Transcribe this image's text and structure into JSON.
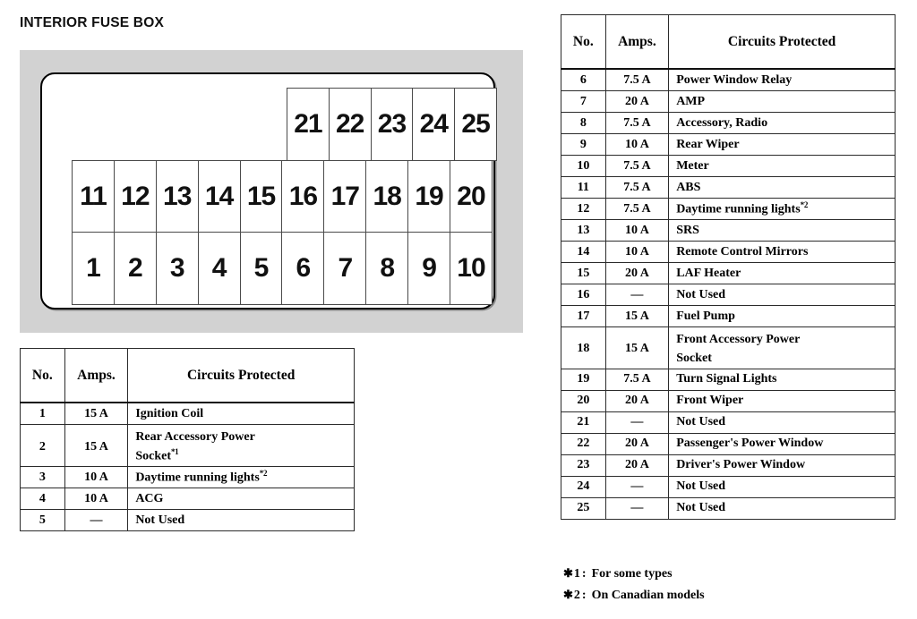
{
  "page_title": "INTERIOR FUSE BOX",
  "diagram": {
    "name": "interior-fuse-box-layout",
    "rows": {
      "top": [
        "21",
        "22",
        "23",
        "24",
        "25"
      ],
      "middle": [
        "11",
        "12",
        "13",
        "14",
        "15",
        "16",
        "17",
        "18",
        "19",
        "20"
      ],
      "bottom": [
        "1",
        "2",
        "3",
        "4",
        "5",
        "6",
        "7",
        "8",
        "9",
        "10"
      ]
    },
    "background_color": "#d2d2d2",
    "panel_color": "#ffffff"
  },
  "table_headers": {
    "no": "No.",
    "amps": "Amps.",
    "circuits": "Circuits Protected"
  },
  "left_table": {
    "rows": [
      {
        "no": "1",
        "amps": "15 A",
        "circuit": "Ignition Coil"
      },
      {
        "no": "2",
        "amps": "15 A",
        "circuit_line1": "Rear Accessory Power",
        "circuit_line2": "Socket",
        "footnote": "*1",
        "tall": true
      },
      {
        "no": "3",
        "amps": "10 A",
        "circuit": "Daytime running lights",
        "footnote": "*2"
      },
      {
        "no": "4",
        "amps": "10 A",
        "circuit": "ACG"
      },
      {
        "no": "5",
        "amps": "—",
        "circuit": "Not Used"
      }
    ]
  },
  "right_table": {
    "rows": [
      {
        "no": "6",
        "amps": "7.5 A",
        "circuit": "Power Window Relay"
      },
      {
        "no": "7",
        "amps": "20 A",
        "circuit": "AMP"
      },
      {
        "no": "8",
        "amps": "7.5 A",
        "circuit": "Accessory, Radio"
      },
      {
        "no": "9",
        "amps": "10 A",
        "circuit": "Rear Wiper"
      },
      {
        "no": "10",
        "amps": "7.5 A",
        "circuit": "Meter"
      },
      {
        "no": "11",
        "amps": "7.5 A",
        "circuit": "ABS"
      },
      {
        "no": "12",
        "amps": "7.5 A",
        "circuit": "Daytime running lights",
        "footnote": "*2"
      },
      {
        "no": "13",
        "amps": "10 A",
        "circuit": "SRS"
      },
      {
        "no": "14",
        "amps": "10 A",
        "circuit": "Remote Control Mirrors"
      },
      {
        "no": "15",
        "amps": "20 A",
        "circuit": "LAF Heater"
      },
      {
        "no": "16",
        "amps": "—",
        "circuit": "Not Used"
      },
      {
        "no": "17",
        "amps": "15 A",
        "circuit": "Fuel Pump"
      },
      {
        "no": "18",
        "amps": "15 A",
        "circuit_line1": "Front Accessory Power",
        "circuit_line2": "Socket",
        "tall": true
      },
      {
        "no": "19",
        "amps": "7.5 A",
        "circuit": "Turn Signal Lights"
      },
      {
        "no": "20",
        "amps": "20 A",
        "circuit": "Front Wiper"
      },
      {
        "no": "21",
        "amps": "—",
        "circuit": "Not Used"
      },
      {
        "no": "22",
        "amps": "20 A",
        "circuit": "Passenger's Power Window"
      },
      {
        "no": "23",
        "amps": "20 A",
        "circuit": "Driver's Power Window"
      },
      {
        "no": "24",
        "amps": "—",
        "circuit": "Not Used"
      },
      {
        "no": "25",
        "amps": "—",
        "circuit": "Not Used"
      }
    ]
  },
  "footnotes": [
    {
      "marker": "✱",
      "num": "1",
      "colon": ":",
      "text": "For some types"
    },
    {
      "marker": "✱",
      "num": "2",
      "colon": ":",
      "text": "On Canadian models"
    }
  ]
}
